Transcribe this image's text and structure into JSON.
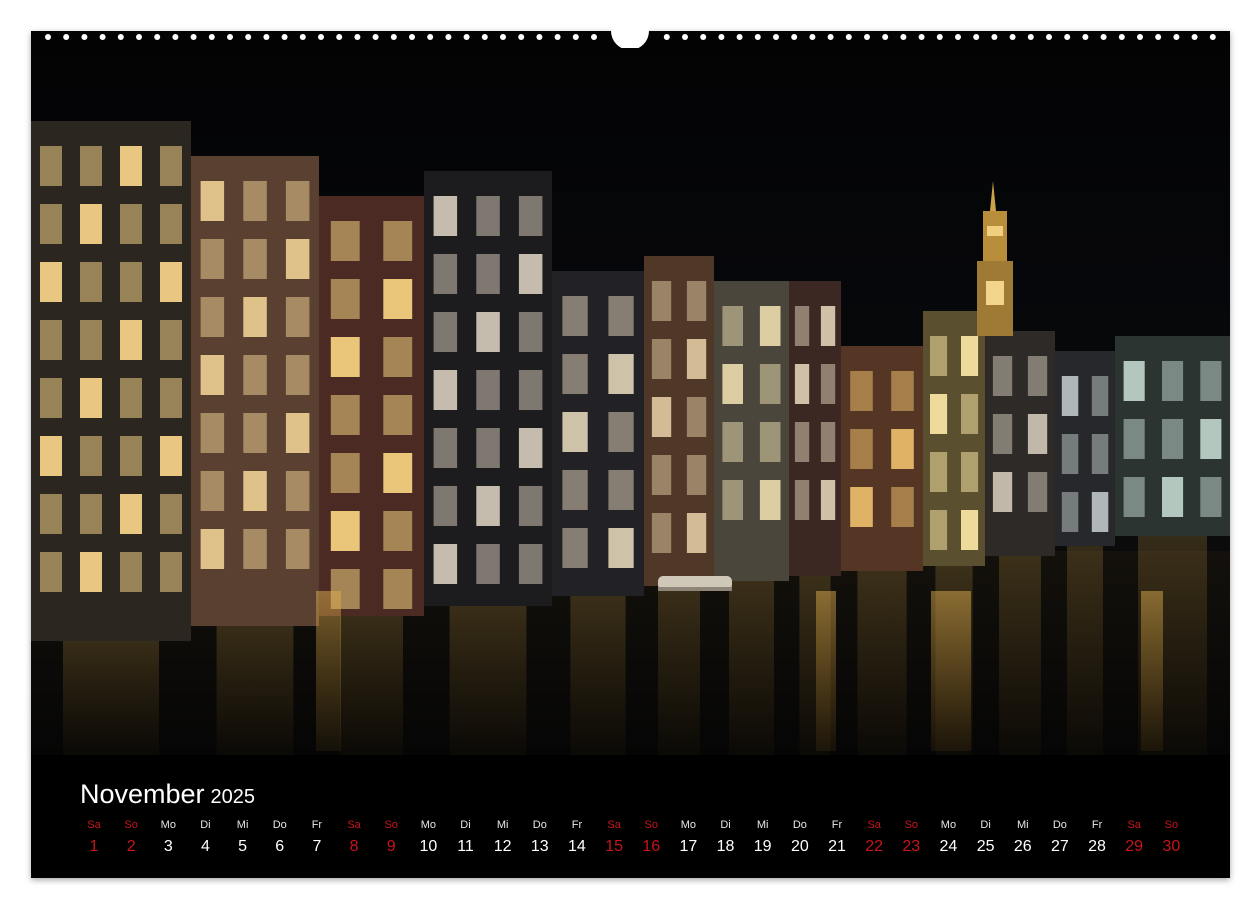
{
  "calendar": {
    "month": "November",
    "year": "2025",
    "days": [
      {
        "name": "Sa",
        "num": "1",
        "weekend": true
      },
      {
        "name": "So",
        "num": "2",
        "weekend": true
      },
      {
        "name": "Mo",
        "num": "3",
        "weekend": false
      },
      {
        "name": "Di",
        "num": "4",
        "weekend": false
      },
      {
        "name": "Mi",
        "num": "5",
        "weekend": false
      },
      {
        "name": "Do",
        "num": "6",
        "weekend": false
      },
      {
        "name": "Fr",
        "num": "7",
        "weekend": false
      },
      {
        "name": "Sa",
        "num": "8",
        "weekend": true
      },
      {
        "name": "So",
        "num": "9",
        "weekend": true
      },
      {
        "name": "Mo",
        "num": "10",
        "weekend": false
      },
      {
        "name": "Di",
        "num": "11",
        "weekend": false
      },
      {
        "name": "Mi",
        "num": "12",
        "weekend": false
      },
      {
        "name": "Do",
        "num": "13",
        "weekend": false
      },
      {
        "name": "Fr",
        "num": "14",
        "weekend": false
      },
      {
        "name": "Sa",
        "num": "15",
        "weekend": true
      },
      {
        "name": "So",
        "num": "16",
        "weekend": true
      },
      {
        "name": "Mo",
        "num": "17",
        "weekend": false
      },
      {
        "name": "Di",
        "num": "18",
        "weekend": false
      },
      {
        "name": "Mi",
        "num": "19",
        "weekend": false
      },
      {
        "name": "Do",
        "num": "20",
        "weekend": false
      },
      {
        "name": "Fr",
        "num": "21",
        "weekend": false
      },
      {
        "name": "Sa",
        "num": "22",
        "weekend": true
      },
      {
        "name": "So",
        "num": "23",
        "weekend": true
      },
      {
        "name": "Mo",
        "num": "24",
        "weekend": false
      },
      {
        "name": "Di",
        "num": "25",
        "weekend": false
      },
      {
        "name": "Mi",
        "num": "26",
        "weekend": false
      },
      {
        "name": "Do",
        "num": "27",
        "weekend": false
      },
      {
        "name": "Fr",
        "num": "28",
        "weekend": false
      },
      {
        "name": "Sa",
        "num": "29",
        "weekend": true
      },
      {
        "name": "So",
        "num": "30",
        "weekend": true
      }
    ]
  },
  "colors": {
    "weekend": "#c8141b",
    "weekday": "#ffffff",
    "background": "#000000"
  }
}
